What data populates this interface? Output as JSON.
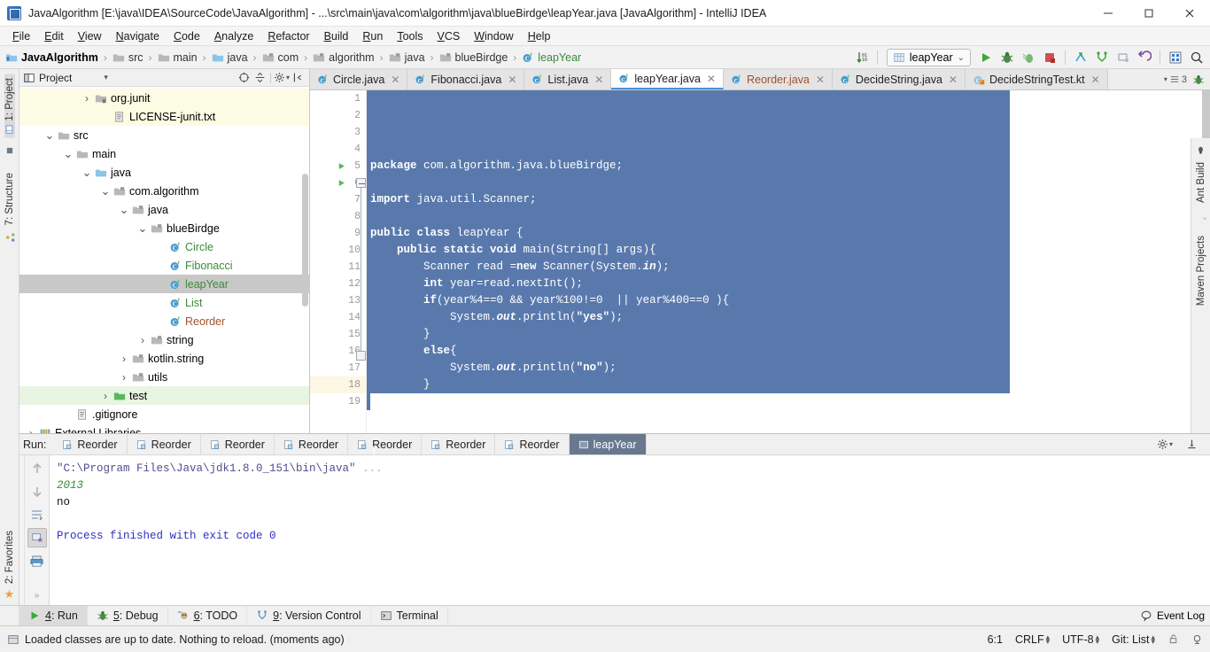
{
  "window": {
    "title": "JavaAlgorithm [E:\\java\\IDEA\\SourceCode\\JavaAlgorithm] - ...\\src\\main\\java\\com\\algorithm\\java\\blueBirdge\\leapYear.java [JavaAlgorithm] - IntelliJ IDEA",
    "minimize": "—",
    "maximize": "❐",
    "close": "✕"
  },
  "menu": [
    "File",
    "Edit",
    "View",
    "Navigate",
    "Code",
    "Analyze",
    "Refactor",
    "Build",
    "Run",
    "Tools",
    "VCS",
    "Window",
    "Help"
  ],
  "breadcrumb": [
    {
      "label": "JavaAlgorithm",
      "icon": "module-icon"
    },
    {
      "label": "src",
      "icon": "folder-icon"
    },
    {
      "label": "main",
      "icon": "folder-icon"
    },
    {
      "label": "java",
      "icon": "source-folder-icon"
    },
    {
      "label": "com",
      "icon": "package-icon"
    },
    {
      "label": "algorithm",
      "icon": "package-icon"
    },
    {
      "label": "java",
      "icon": "package-icon"
    },
    {
      "label": "blueBirdge",
      "icon": "package-icon"
    },
    {
      "label": "leapYear",
      "icon": "class-icon"
    }
  ],
  "toolbar": {
    "sort_icon": "sort-numeric-icon",
    "run_config": "leapYear",
    "run_config_caret": "⌄",
    "buttons": [
      {
        "name": "run-button",
        "icon": "play-icon"
      },
      {
        "name": "debug-button",
        "icon": "bug-icon"
      },
      {
        "name": "run-coverage-button",
        "icon": "coverage-icon"
      },
      {
        "name": "stop-button",
        "icon": "stop-icon"
      },
      {
        "name": "update-project-button",
        "icon": "vcs-update-icon"
      },
      {
        "name": "commit-button",
        "icon": "vcs-commit-icon"
      },
      {
        "name": "push-button",
        "icon": "vcs-push-icon"
      },
      {
        "name": "rollback-button",
        "icon": "vcs-rollback-icon"
      },
      {
        "name": "database-button",
        "icon": "database-icon"
      },
      {
        "name": "search-everywhere-button",
        "icon": "search-icon"
      }
    ]
  },
  "project_pane": {
    "title": "Project",
    "title_caret": "▾",
    "header_buttons": [
      {
        "name": "collapse-all-button",
        "icon": "target-icon"
      },
      {
        "name": "expand-all-button",
        "icon": "collapse-icon"
      },
      {
        "name": "settings-button",
        "icon": "gear-icon"
      },
      {
        "name": "hide-button",
        "icon": "hide-icon"
      }
    ],
    "tree": [
      {
        "label": "org.junit",
        "indent": 3,
        "arrow": "›",
        "icon": "library-icon",
        "state": "yellow"
      },
      {
        "label": "LICENSE-junit.txt",
        "indent": 4,
        "arrow": "",
        "icon": "library-file-icon",
        "state": "yellow"
      },
      {
        "label": "src",
        "indent": 1,
        "arrow": "⌄",
        "icon": "folder-icon",
        "state": ""
      },
      {
        "label": "main",
        "indent": 2,
        "arrow": "⌄",
        "icon": "folder-icon",
        "state": ""
      },
      {
        "label": "java",
        "indent": 3,
        "arrow": "⌄",
        "icon": "source-folder-icon",
        "state": ""
      },
      {
        "label": "com.algorithm",
        "indent": 4,
        "arrow": "⌄",
        "icon": "package-icon",
        "state": ""
      },
      {
        "label": "java",
        "indent": 5,
        "arrow": "⌄",
        "icon": "package-icon",
        "state": ""
      },
      {
        "label": "blueBirdge",
        "indent": 6,
        "arrow": "⌄",
        "icon": "package-icon",
        "state": ""
      },
      {
        "label": "Circle",
        "indent": 7,
        "arrow": "",
        "icon": "class-icon",
        "state": ""
      },
      {
        "label": "Fibonacci",
        "indent": 7,
        "arrow": "",
        "icon": "class-icon",
        "state": ""
      },
      {
        "label": "leapYear",
        "indent": 7,
        "arrow": "",
        "icon": "class-icon",
        "state": "selected"
      },
      {
        "label": "List",
        "indent": 7,
        "arrow": "",
        "icon": "class-icon",
        "state": ""
      },
      {
        "label": "Reorder",
        "indent": 7,
        "arrow": "",
        "icon": "class-icon",
        "state": "brown"
      },
      {
        "label": "string",
        "indent": 6,
        "arrow": "›",
        "icon": "package-icon",
        "state": ""
      },
      {
        "label": "kotlin.string",
        "indent": 5,
        "arrow": "›",
        "icon": "package-icon",
        "state": ""
      },
      {
        "label": "utils",
        "indent": 5,
        "arrow": "›",
        "icon": "package-icon",
        "state": ""
      },
      {
        "label": "test",
        "indent": 4,
        "arrow": "›",
        "icon": "test-folder-icon",
        "state": "green"
      },
      {
        "label": ".gitignore",
        "indent": 2,
        "arrow": "",
        "icon": "file-icon",
        "state": ""
      },
      {
        "label": "External Libraries",
        "indent": 0,
        "arrow": "›",
        "icon": "libraries-icon",
        "state": ""
      }
    ]
  },
  "left_strip": [
    {
      "label": "1: Project",
      "icon": "project-icon",
      "active": true
    },
    {
      "label": "7: Structure",
      "icon": "structure-icon",
      "active": false
    }
  ],
  "left_strip_bottom": [
    {
      "label": "2: Favorites",
      "icon": "star-icon"
    }
  ],
  "right_strip": [
    {
      "label": "Ant Build",
      "icon": "ant-icon"
    },
    {
      "label": "Maven Projects",
      "icon": "maven-icon"
    }
  ],
  "editor_tabs": [
    {
      "label": "Circle.java",
      "icon": "java-class-icon",
      "active": false,
      "color": "normal"
    },
    {
      "label": "Fibonacci.java",
      "icon": "java-class-icon",
      "active": false,
      "color": "normal"
    },
    {
      "label": "List.java",
      "icon": "java-class-icon",
      "active": false,
      "color": "normal"
    },
    {
      "label": "leapYear.java",
      "icon": "java-class-icon",
      "active": true,
      "color": "normal"
    },
    {
      "label": "Reorder.java",
      "icon": "java-class-icon",
      "active": false,
      "color": "brown"
    },
    {
      "label": "DecideString.java",
      "icon": "java-class-icon",
      "active": false,
      "color": "normal"
    },
    {
      "label": "DecideStringTest.kt",
      "icon": "kotlin-class-icon",
      "active": false,
      "color": "normal"
    }
  ],
  "editor_tabs_right": {
    "inspection_count": "3",
    "inspection_icon": "inspections-icon",
    "debug_icon": "bug-icon"
  },
  "editor": {
    "line_numbers": [
      "1",
      "2",
      "3",
      "4",
      "5",
      "6",
      "7",
      "8",
      "9",
      "10",
      "11",
      "12",
      "13",
      "14",
      "15",
      "16",
      "17",
      "18",
      "19"
    ],
    "current_line": 18,
    "lines": [
      {
        "n": 1,
        "tokens": [
          {
            "t": "package ",
            "c": "kw"
          },
          {
            "t": "com.algorithm.java.blueBirdge;",
            "c": "txt"
          }
        ],
        "gutter": ""
      },
      {
        "n": 2,
        "tokens": [],
        "gutter": ""
      },
      {
        "n": 3,
        "tokens": [
          {
            "t": "import ",
            "c": "kw"
          },
          {
            "t": "java.util.Scanner;",
            "c": "txt"
          }
        ],
        "gutter": ""
      },
      {
        "n": 4,
        "tokens": [],
        "gutter": ""
      },
      {
        "n": 5,
        "tokens": [
          {
            "t": "public class ",
            "c": "kw"
          },
          {
            "t": "leapYear {",
            "c": "txt"
          }
        ],
        "gutter": "run-gutter-icon"
      },
      {
        "n": 6,
        "tokens": [
          {
            "t": "    ",
            "c": "txt"
          },
          {
            "t": "public static void ",
            "c": "kw"
          },
          {
            "t": "main(String[] args){",
            "c": "txt"
          }
        ],
        "gutter": "run-gutter-icon"
      },
      {
        "n": 7,
        "tokens": [
          {
            "t": "        Scanner read =",
            "c": "txt"
          },
          {
            "t": "new ",
            "c": "kw"
          },
          {
            "t": "Scanner(System.",
            "c": "txt"
          },
          {
            "t": "in",
            "c": "fld"
          },
          {
            "t": ");",
            "c": "txt"
          }
        ],
        "gutter": ""
      },
      {
        "n": 8,
        "tokens": [
          {
            "t": "        ",
            "c": "txt"
          },
          {
            "t": "int ",
            "c": "kw"
          },
          {
            "t": "year=read.nextInt();",
            "c": "txt"
          }
        ],
        "gutter": ""
      },
      {
        "n": 9,
        "tokens": [
          {
            "t": "        ",
            "c": "txt"
          },
          {
            "t": "if",
            "c": "kw"
          },
          {
            "t": "(year%4==0 && year%100!=0  || year%400==0 ){",
            "c": "txt"
          }
        ],
        "gutter": ""
      },
      {
        "n": 10,
        "tokens": [
          {
            "t": "            System.",
            "c": "txt"
          },
          {
            "t": "out",
            "c": "fld"
          },
          {
            "t": ".println(",
            "c": "txt"
          },
          {
            "t": "\"yes\"",
            "c": "str"
          },
          {
            "t": ");",
            "c": "txt"
          }
        ],
        "gutter": ""
      },
      {
        "n": 11,
        "tokens": [
          {
            "t": "        }",
            "c": "txt"
          }
        ],
        "gutter": ""
      },
      {
        "n": 12,
        "tokens": [
          {
            "t": "        ",
            "c": "txt"
          },
          {
            "t": "else",
            "c": "kw"
          },
          {
            "t": "{",
            "c": "txt"
          }
        ],
        "gutter": ""
      },
      {
        "n": 13,
        "tokens": [
          {
            "t": "            System.",
            "c": "txt"
          },
          {
            "t": "out",
            "c": "fld"
          },
          {
            "t": ".println(",
            "c": "txt"
          },
          {
            "t": "\"no\"",
            "c": "str"
          },
          {
            "t": ");",
            "c": "txt"
          }
        ],
        "gutter": ""
      },
      {
        "n": 14,
        "tokens": [
          {
            "t": "        }",
            "c": "txt"
          }
        ],
        "gutter": ""
      },
      {
        "n": 15,
        "tokens": [],
        "gutter": ""
      },
      {
        "n": 16,
        "tokens": [
          {
            "t": "    }",
            "c": "txt"
          }
        ],
        "gutter": ""
      },
      {
        "n": 17,
        "tokens": [],
        "gutter": ""
      },
      {
        "n": 18,
        "tokens": [
          {
            "t": "}",
            "c": "txt"
          }
        ],
        "gutter": ""
      },
      {
        "n": 19,
        "tokens": [],
        "gutter": ""
      }
    ]
  },
  "run_window": {
    "label": "Run:",
    "tabs": [
      {
        "label": "Reorder",
        "active": false
      },
      {
        "label": "Reorder",
        "active": false
      },
      {
        "label": "Reorder",
        "active": false
      },
      {
        "label": "Reorder",
        "active": false
      },
      {
        "label": "Reorder",
        "active": false
      },
      {
        "label": "Reorder",
        "active": false
      },
      {
        "label": "Reorder",
        "active": false
      },
      {
        "label": "leapYear",
        "active": true
      }
    ],
    "right_buttons": [
      {
        "name": "settings-button",
        "icon": "gear-icon"
      },
      {
        "name": "pin-button",
        "icon": "pin-icon"
      }
    ],
    "toolbar_left": [
      {
        "name": "rerun-button",
        "icon": "play-icon"
      },
      {
        "name": "stop-button",
        "icon": "stop-icon"
      },
      {
        "name": "pause-button",
        "icon": "pause-icon"
      },
      {
        "name": "dump-threads-button",
        "icon": "camera-icon"
      },
      {
        "name": "restore-layout-button",
        "icon": "restore-icon"
      },
      {
        "name": "expand-left-button",
        "icon": "chevrons-icon"
      }
    ],
    "toolbar_right": [
      {
        "name": "scroll-up-button",
        "icon": "arrow-up-icon"
      },
      {
        "name": "scroll-down-button",
        "icon": "arrow-down-icon"
      },
      {
        "name": "soft-wrap-button",
        "icon": "wrap-icon"
      },
      {
        "name": "clear-all-button",
        "icon": "clear-icon"
      },
      {
        "name": "print-button",
        "icon": "print-icon"
      },
      {
        "name": "expand-right-button",
        "icon": "chevrons-icon"
      }
    ],
    "console": [
      {
        "text": "\"C:\\Program Files\\Java\\jdk1.8.0_151\\bin\\java\" ",
        "cls": "c-cmd"
      },
      {
        "text": "...",
        "cls": "c-ell"
      },
      {
        "text": "\n",
        "cls": "c-out"
      },
      {
        "text": "2013\n",
        "cls": "c-in"
      },
      {
        "text": "no\n",
        "cls": "c-out"
      },
      {
        "text": "\n",
        "cls": "c-out"
      },
      {
        "text": "Process finished with exit code 0",
        "cls": "c-fin"
      }
    ]
  },
  "tool_strip": [
    {
      "label": "4: Run",
      "icon": "play-icon",
      "active": true
    },
    {
      "label": "5: Debug",
      "icon": "bug-icon",
      "active": false
    },
    {
      "label": "6: TODO",
      "icon": "todo-icon",
      "active": false
    },
    {
      "label": "9: Version Control",
      "icon": "vcs-icon",
      "active": false
    },
    {
      "label": "Terminal",
      "icon": "terminal-icon",
      "active": false
    }
  ],
  "tool_strip_right": {
    "event_log": "Event Log",
    "event_log_icon": "balloon-icon"
  },
  "status_bar": {
    "message": "Loaded classes are up to date. Nothing to reload. (moments ago)",
    "message_icon": "hotswap-icon",
    "caret_position": "6:1",
    "line_separator": "CRLF",
    "encoding": "UTF-8",
    "branch": "Git: List",
    "lock_icon": "unlock-icon",
    "inspection_icon": "inspections-widget-icon"
  },
  "colors": {
    "selection": "#5979ad",
    "accent": "#4a90d9",
    "tab_active": "#68788f",
    "green": "#3a8a3a",
    "brown": "#a0522d",
    "current_line": "#fdf6e3"
  }
}
